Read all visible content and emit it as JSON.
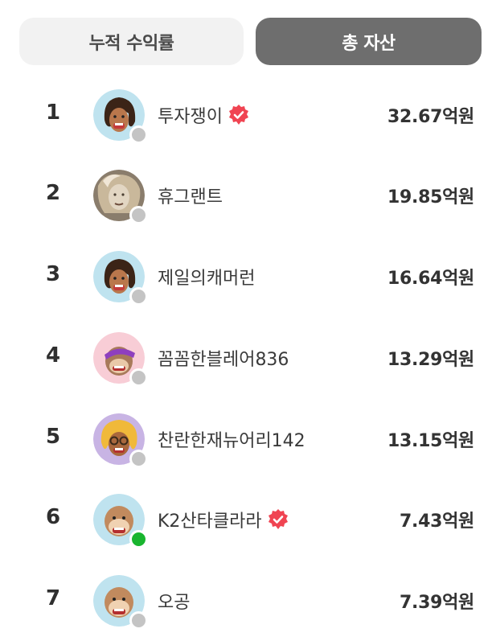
{
  "tabs": {
    "cumulative_return": "누적 수익률",
    "total_assets": "총 자산"
  },
  "rankings": [
    {
      "rank": "1",
      "name": "투자쟁이",
      "value": "32.67억원",
      "verified": true,
      "online": false,
      "avatar": "woman-curly-hair"
    },
    {
      "rank": "2",
      "name": "휴그랜트",
      "value": "19.85억원",
      "verified": false,
      "online": false,
      "avatar": "photo-portrait"
    },
    {
      "rank": "3",
      "name": "제일의캐머런",
      "value": "16.64억원",
      "verified": false,
      "online": false,
      "avatar": "woman-curly-hair"
    },
    {
      "rank": "4",
      "name": "꼼꼼한블레어836",
      "value": "13.29억원",
      "verified": false,
      "online": false,
      "avatar": "monkey-purple-cap"
    },
    {
      "rank": "5",
      "name": "찬란한재뉴어리142",
      "value": "13.15억원",
      "verified": false,
      "online": false,
      "avatar": "blonde-glasses"
    },
    {
      "rank": "6",
      "name": "K2산타클라라",
      "value": "7.43억원",
      "verified": true,
      "online": true,
      "avatar": "monkey"
    },
    {
      "rank": "7",
      "name": "오공",
      "value": "7.39억원",
      "verified": false,
      "online": false,
      "avatar": "monkey"
    }
  ],
  "colors": {
    "tab_active_bg": "#6e6e6e",
    "tab_inactive_bg": "#f2f2f2",
    "verified_badge": "#f04452",
    "online_dot": "#19b52f",
    "offline_dot": "#c4c4c4"
  }
}
